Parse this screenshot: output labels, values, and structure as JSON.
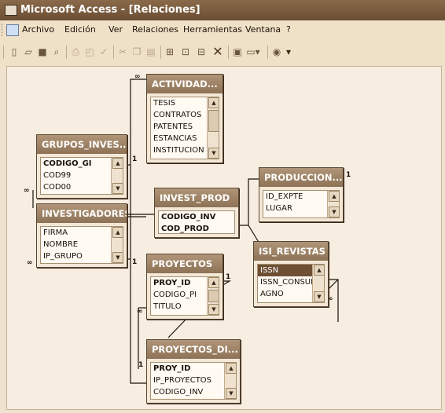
{
  "window": {
    "title": "Microsoft Access - [Relaciones]"
  },
  "menu": {
    "items": [
      "Archivo",
      "Edición",
      "Ver",
      "Relaciones",
      "Herramientas",
      "Ventana",
      "?"
    ]
  },
  "toolbar": {
    "icons": [
      "new-icon",
      "open-icon",
      "save-icon",
      "search-icon",
      "print-icon",
      "print-preview-icon",
      "spelling-icon",
      "cut-icon",
      "copy-icon",
      "paste-icon",
      "show-table-icon",
      "direct-relationships-icon",
      "all-relationships-icon",
      "delete-icon",
      "new-object-icon",
      "database-window-icon",
      "help-icon"
    ]
  },
  "relationship_labels": {
    "one": "1",
    "many": "∞"
  },
  "tables": {
    "actividad": {
      "title": "ACTIVIDAD...",
      "fields": [
        "TESIS",
        "CONTRATOS",
        "PATENTES",
        "ESTANCIAS",
        "INSTITUCION"
      ]
    },
    "grupos": {
      "title": "GRUPOS_INVES...",
      "fields": [
        "CODIGO_GI",
        "COD99",
        "COD00"
      ]
    },
    "investigadores": {
      "title": "INVESTIGADORES",
      "fields": [
        "FIRMA",
        "NOMBRE",
        "IP_GRUPO"
      ]
    },
    "invest_prod": {
      "title": "INVEST_PROD",
      "fields": [
        "CODIGO_INV",
        "COD_PROD"
      ]
    },
    "produccion": {
      "title": "PRODUCCION...",
      "fields": [
        "ID_EXPTE",
        "LUGAR"
      ]
    },
    "isi_revistas": {
      "title": "ISI_REVISTAS",
      "fields": [
        "ISSN",
        "ISSN_CONSUL",
        "AGNO"
      ]
    },
    "proyectos": {
      "title": "PROYECTOS",
      "fields": [
        "PROY_ID",
        "CODIGO_PI",
        "TITULO"
      ]
    },
    "proyectos_di": {
      "title": "PROYECTOS_DI...",
      "fields": [
        "PROY_ID",
        "IP_PROYECTOS",
        "CODIGO_INV"
      ]
    }
  }
}
